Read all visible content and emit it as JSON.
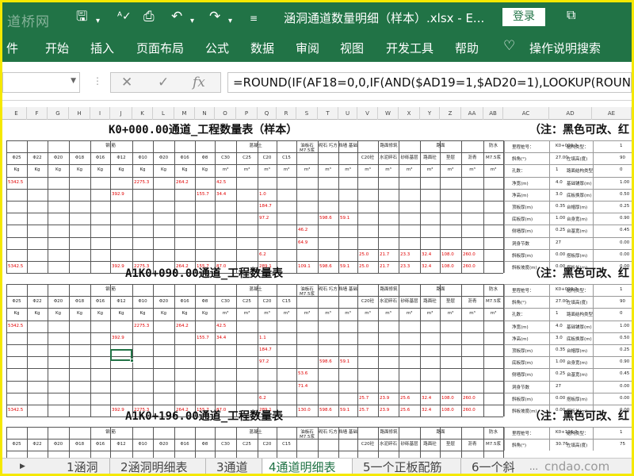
{
  "window": {
    "title": "涵洞通道数量明细（样本）.xlsx  -  E...",
    "login_label": "登录",
    "watermark": "道桥网"
  },
  "quick_access": {
    "save_icon": "save-cloud-icon",
    "undo_icon": "undo-icon",
    "redo_icon": "redo-icon",
    "print_preview_icon": "print-preview-icon",
    "more_icon": "chevron-down-icon"
  },
  "ribbon": {
    "tabs": [
      "件",
      "开始",
      "插入",
      "页面布局",
      "公式",
      "数据",
      "审阅",
      "视图",
      "开发工具",
      "帮助"
    ],
    "tell_me": "操作说明搜索"
  },
  "formula_bar": {
    "cancel_glyph": "✕",
    "enter_glyph": "✓",
    "fx_glyph": "fx",
    "formula": "=ROUND(IF(AF18=0,0,IF(AND($AD19=1,$AD20=1),LOOKUP(ROUND(M"
  },
  "column_headers": [
    "E",
    "F",
    "G",
    "H",
    "I",
    "J",
    "K",
    "L",
    "M",
    "N",
    "O",
    "P",
    "Q",
    "R",
    "S",
    "T",
    "U",
    "V",
    "W",
    "X",
    "Y",
    "Z",
    "AA",
    "AB",
    "AC",
    "AD",
    "AE",
    "AF"
  ],
  "blocks": [
    {
      "title": "K0+000.00通道_工程数量表（样本）",
      "note": "（注：黑色可改、红",
      "group_row": [
        "钢  筋",
        "混凝土",
        "油板石 M7.5浆",
        "砌石 圬方",
        "挡墙 基础",
        "路面修筑",
        "路面",
        "防水"
      ],
      "spec_row": [
        "Φ25",
        "Φ22",
        "Φ20",
        "Φ18",
        "Φ16",
        "Φ12",
        "Φ10",
        "Φ20",
        "Φ16",
        "Φ8",
        "C30",
        "C25",
        "C20",
        "C15",
        "",
        "",
        "",
        "C20砼",
        "水泥碎石",
        "砂砾基层",
        "路面砼",
        "垫层",
        "沥青",
        "M7.5浆"
      ],
      "unit_row": [
        "Kg",
        "Kg",
        "Kg",
        "Kg",
        "Kg",
        "Kg",
        "Kg",
        "Kg",
        "Kg",
        "Kg",
        "m³",
        "m³",
        "m³",
        "m³",
        "m³",
        "m³",
        "m³",
        "m³",
        "m³",
        "m³",
        "m³",
        "m³",
        "m³",
        "m³"
      ],
      "values": [
        [
          "5342.5",
          "",
          "",
          "",
          "",
          "",
          "2275.3",
          "",
          "264.2",
          "",
          "42.5",
          "",
          "",
          "",
          "",
          "",
          "",
          "",
          "",
          "",
          "",
          "",
          "",
          ""
        ],
        [
          "",
          "",
          "",
          "",
          "",
          "392.9",
          "",
          "",
          "",
          "155.7",
          "34.4",
          "",
          "1.0",
          "",
          "",
          "",
          "",
          "",
          "",
          "",
          "",
          "",
          "",
          ""
        ],
        [
          "",
          "",
          "",
          "",
          "",
          "",
          "",
          "",
          "",
          "",
          "",
          "",
          "184.7",
          "",
          "",
          "",
          "",
          "",
          "",
          "",
          "",
          "",
          "",
          ""
        ],
        [
          "",
          "",
          "",
          "",
          "",
          "",
          "",
          "",
          "",
          "",
          "",
          "",
          "97.2",
          "",
          "",
          "598.6",
          "59.1",
          "",
          "",
          "",
          "",
          "",
          "",
          ""
        ],
        [
          "",
          "",
          "",
          "",
          "",
          "",
          "",
          "",
          "",
          "",
          "",
          "",
          "",
          "",
          "46.2",
          "",
          "",
          "",
          "",
          "",
          "",
          "",
          "",
          ""
        ],
        [
          "",
          "",
          "",
          "",
          "",
          "",
          "",
          "",
          "",
          "",
          "",
          "",
          "",
          "",
          "64.9",
          "",
          "",
          "",
          "",
          "",
          "",
          "",
          "",
          ""
        ],
        [
          "",
          "",
          "",
          "",
          "",
          "",
          "",
          "",
          "",
          "",
          "",
          "",
          "6.2",
          "",
          "",
          "",
          "",
          "25.0",
          "21.7",
          "23.3",
          "32.4",
          "108.0",
          "260.0",
          ""
        ],
        [
          "5342.5",
          "",
          "",
          "",
          "",
          "392.9",
          "2275.3",
          "",
          "264.2",
          "155.7",
          "87.0",
          "",
          "289.1",
          "",
          "109.1",
          "598.6",
          "59.1",
          "25.0",
          "21.7",
          "23.3",
          "32.4",
          "108.0",
          "260.0",
          ""
        ]
      ],
      "side": [
        [
          "里程桩号：",
          "K0+000.0",
          "结构类型：",
          "1"
        ],
        [
          "斜角(°)",
          "27.00",
          "左填高(度)",
          "90"
        ],
        [
          "孔数：",
          "1",
          "路面结构类型",
          "0"
        ],
        [
          "净宽(m)",
          "4.0",
          "基础铺厚(m)",
          "1.00"
        ],
        [
          "净高(m)",
          "3.0",
          "底板换厚(m)",
          "0.50"
        ],
        [
          "顶板厚(m)",
          "0.35",
          "台帽厚(m)",
          "0.25"
        ],
        [
          "底板厚(m)",
          "1.00",
          "台身宽(m)",
          "0.90"
        ],
        [
          "侧墙厚(m)",
          "0.25",
          "台基宽(m)",
          "0.45"
        ],
        [
          "洞身节数",
          "27",
          "",
          "0.00"
        ],
        [
          "斜板厚(m)",
          "0.00",
          "搭板厚(m)",
          "0.00"
        ],
        [
          "斜板坡度(m)",
          "0.00",
          "搭板长(m)",
          "0.00"
        ]
      ]
    },
    {
      "title": "A1K0+090.00通道_工程数量表",
      "note": "（注：黑色可改、红",
      "group_row": [
        "钢  筋",
        "混凝土",
        "油板石 M7.5浆",
        "砌石 圬方",
        "挡墙 基础",
        "路面修筑",
        "路面",
        "防水"
      ],
      "spec_row": [
        "Φ25",
        "Φ22",
        "Φ20",
        "Φ18",
        "Φ16",
        "Φ12",
        "Φ10",
        "Φ20",
        "Φ16",
        "Φ8",
        "C30",
        "C25",
        "C20",
        "C15",
        "",
        "",
        "",
        "C20砼",
        "水泥碎石",
        "砂砾基层",
        "路面砼",
        "垫层",
        "沥青",
        "M7.5浆"
      ],
      "unit_row": [
        "Kg",
        "Kg",
        "Kg",
        "Kg",
        "Kg",
        "Kg",
        "Kg",
        "Kg",
        "Kg",
        "Kg",
        "m³",
        "m³",
        "m³",
        "m³",
        "m³",
        "m³",
        "m³",
        "m³",
        "m³",
        "m³",
        "m³",
        "m³",
        "m³",
        "m³"
      ],
      "values": [
        [
          "5342.5",
          "",
          "",
          "",
          "",
          "",
          "2275.3",
          "",
          "264.2",
          "",
          "42.5",
          "",
          "",
          "",
          "",
          "",
          "",
          "",
          "",
          "",
          "",
          "",
          "",
          ""
        ],
        [
          "",
          "",
          "",
          "",
          "",
          "392.9",
          "",
          "",
          "",
          "155.7",
          "34.4",
          "",
          "1.1",
          "",
          "",
          "",
          "",
          "",
          "",
          "",
          "",
          "",
          "",
          ""
        ],
        [
          "",
          "",
          "",
          "",
          "",
          "",
          "",
          "",
          "",
          "",
          "",
          "",
          "184.7",
          "",
          "",
          "",
          "",
          "",
          "",
          "",
          "",
          "",
          "",
          ""
        ],
        [
          "",
          "",
          "",
          "",
          "",
          "",
          "",
          "",
          "",
          "",
          "",
          "",
          "97.2",
          "",
          "",
          "598.6",
          "59.1",
          "",
          "",
          "",
          "",
          "",
          "",
          ""
        ],
        [
          "",
          "",
          "",
          "",
          "",
          "",
          "",
          "",
          "",
          "",
          "",
          "",
          "",
          "",
          "53.6",
          "",
          "",
          "",
          "",
          "",
          "",
          "",
          "",
          ""
        ],
        [
          "",
          "",
          "",
          "",
          "",
          "",
          "",
          "",
          "",
          "",
          "",
          "",
          "",
          "",
          "71.4",
          "",
          "",
          "",
          "",
          "",
          "",
          "",
          "",
          ""
        ],
        [
          "",
          "",
          "",
          "",
          "",
          "",
          "",
          "",
          "",
          "",
          "",
          "",
          "6.2",
          "",
          "",
          "",
          "",
          "25.7",
          "23.9",
          "25.6",
          "32.4",
          "108.0",
          "260.0",
          ""
        ],
        [
          "5342.5",
          "",
          "",
          "",
          "",
          "392.9",
          "2275.3",
          "",
          "264.2",
          "155.7",
          "87.0",
          "",
          "289.1",
          "",
          "130.0",
          "598.6",
          "59.1",
          "25.7",
          "23.9",
          "25.6",
          "32.4",
          "108.0",
          "260.0",
          ""
        ]
      ],
      "side": [
        [
          "里程桩号：",
          "K0+090.0",
          "结构类型：",
          "1"
        ],
        [
          "斜角(°)",
          "27.00",
          "左填高(度)",
          "90"
        ],
        [
          "孔数：",
          "1",
          "路面结构类型",
          "0"
        ],
        [
          "净宽(m)",
          "4.0",
          "基础铺厚(m)",
          "1.00"
        ],
        [
          "净高(m)",
          "3.0",
          "底板换厚(m)",
          "0.50"
        ],
        [
          "顶板厚(m)",
          "0.35",
          "台帽厚(m)",
          "0.25"
        ],
        [
          "底板厚(m)",
          "1.00",
          "台身宽(m)",
          "0.90"
        ],
        [
          "侧墙厚(m)",
          "0.25",
          "台基宽(m)",
          "0.45"
        ],
        [
          "洞身节数",
          "27",
          "",
          "0.00"
        ],
        [
          "斜板厚(m)",
          "0.00",
          "搭板厚(m)",
          "0.00"
        ],
        [
          "斜板坡度(m)",
          "0.00",
          "搭板长(m)",
          "0.00"
        ]
      ]
    },
    {
      "title": "A1K0+196.00通道_工程数量表",
      "note": "（注：黑色可改、红",
      "group_row": [
        "钢  筋",
        "混凝土",
        "油板石 M7.5浆",
        "砌石 圬方",
        "挡墙 基础",
        "路面修筑",
        "路面",
        "防水"
      ],
      "spec_row": [
        "Φ25",
        "Φ22",
        "Φ20",
        "Φ18",
        "Φ16",
        "Φ12",
        "Φ10",
        "Φ20",
        "Φ16",
        "Φ8",
        "C30",
        "C25",
        "C20",
        "C15",
        "",
        "",
        "",
        "C20砼",
        "水泥碎石",
        "砂砾基层",
        "路面砼",
        "垫层",
        "沥青",
        "M7.5浆"
      ],
      "unit_row": [],
      "values": [],
      "side": [
        [
          "里程桩号：",
          "K0+196.0",
          "结构类型：",
          "1"
        ],
        [
          "斜角(°)",
          "30.76",
          "左填高(度)",
          "75"
        ]
      ]
    }
  ],
  "sheet_tabs": [
    "1涵洞",
    "2涵洞明细表",
    "3通道",
    "4通道明细表",
    "5一个正板配筋",
    "6一个斜"
  ],
  "active_tab": "4通道明细表",
  "corner_watermark": "cndao.com"
}
